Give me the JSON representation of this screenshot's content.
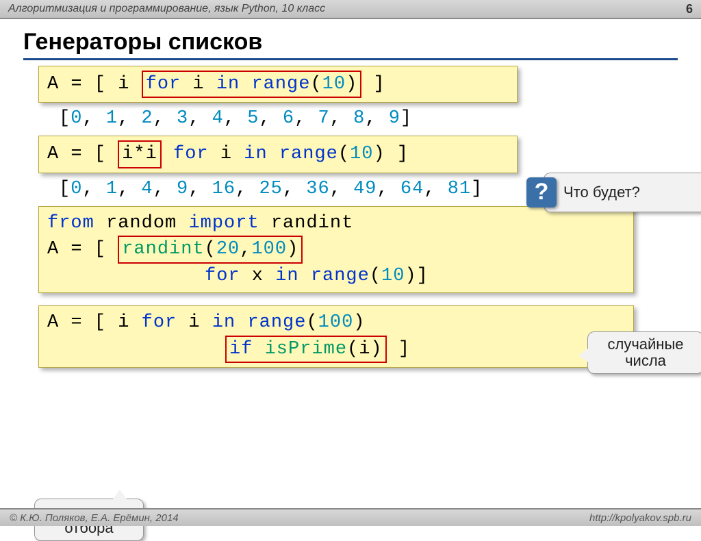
{
  "header": {
    "subject": "Алгоритмизация и программирование, язык Python, 10 класс",
    "pageno": "6"
  },
  "title": "Генераторы списков",
  "code1": {
    "pre": "A = [ i ",
    "box": "for i in range(10)",
    "post": " ]"
  },
  "out1": "[0, 1, 2, 3, 4, 5, 6, 7, 8, 9]",
  "callout_q": "Что будет?",
  "code2": {
    "pre": "A = [ ",
    "box": "i*i",
    "post": " for i in range(10) ]"
  },
  "out2": "[0, 1, 4, 9, 16, 25, 36, 49, 64, 81]",
  "code3": {
    "line1_from": "from",
    "line1_rand": " random ",
    "line1_import": "import",
    "line1_randint": " randint",
    "line2_pre": "A = [ ",
    "line2_box_fun": "randint",
    "line2_box_args": "(20,100)",
    "line3": "for x in range(10)]"
  },
  "callout_rand": "случайные числа",
  "code4": {
    "line1": "A = [ i for i in range(100)",
    "line2_pre": "           ",
    "line2_box_if": "if",
    "line2_box_fun": " isPrime(i)",
    "line2_post": " ]"
  },
  "callout_filter": "условие отбора",
  "footer": {
    "left": "© К.Ю. Поляков, Е.А. Ерёмин, 2014",
    "right": "http://kpolyakov.spb.ru"
  }
}
